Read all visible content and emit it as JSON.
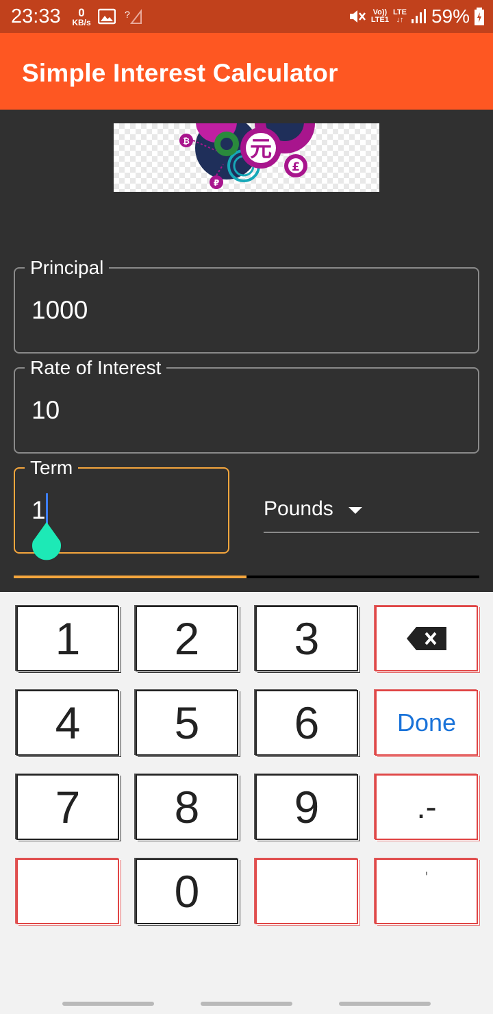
{
  "status_bar": {
    "time": "23:33",
    "net_speed_value": "0",
    "net_speed_unit": "KB/s",
    "battery": "59%",
    "volte": "Vo))",
    "lte1": "LTE1",
    "lte": "LTE"
  },
  "app_bar": {
    "title": "Simple Interest Calculator"
  },
  "form": {
    "principal": {
      "label": "Principal",
      "value": "1000"
    },
    "rate": {
      "label": "Rate of Interest",
      "value": "10"
    },
    "term": {
      "label": "Term",
      "value": "1"
    },
    "currency": {
      "selected": "Pounds"
    }
  },
  "keypad": {
    "keys": {
      "k1": "1",
      "k2": "2",
      "k3": "3",
      "k4": "4",
      "k5": "5",
      "k6": "6",
      "k7": "7",
      "k8": "8",
      "k9": "9",
      "k0": "0",
      "done": "Done",
      "dot_minus": ".-",
      "apostrophe": "'"
    }
  },
  "colors": {
    "status_bar": "#c1411c",
    "app_bar": "#fe5722",
    "background": "#303030",
    "focus": "#f5a63d",
    "cursor_handle": "#1de9b6",
    "done_text": "#1a73d9"
  }
}
